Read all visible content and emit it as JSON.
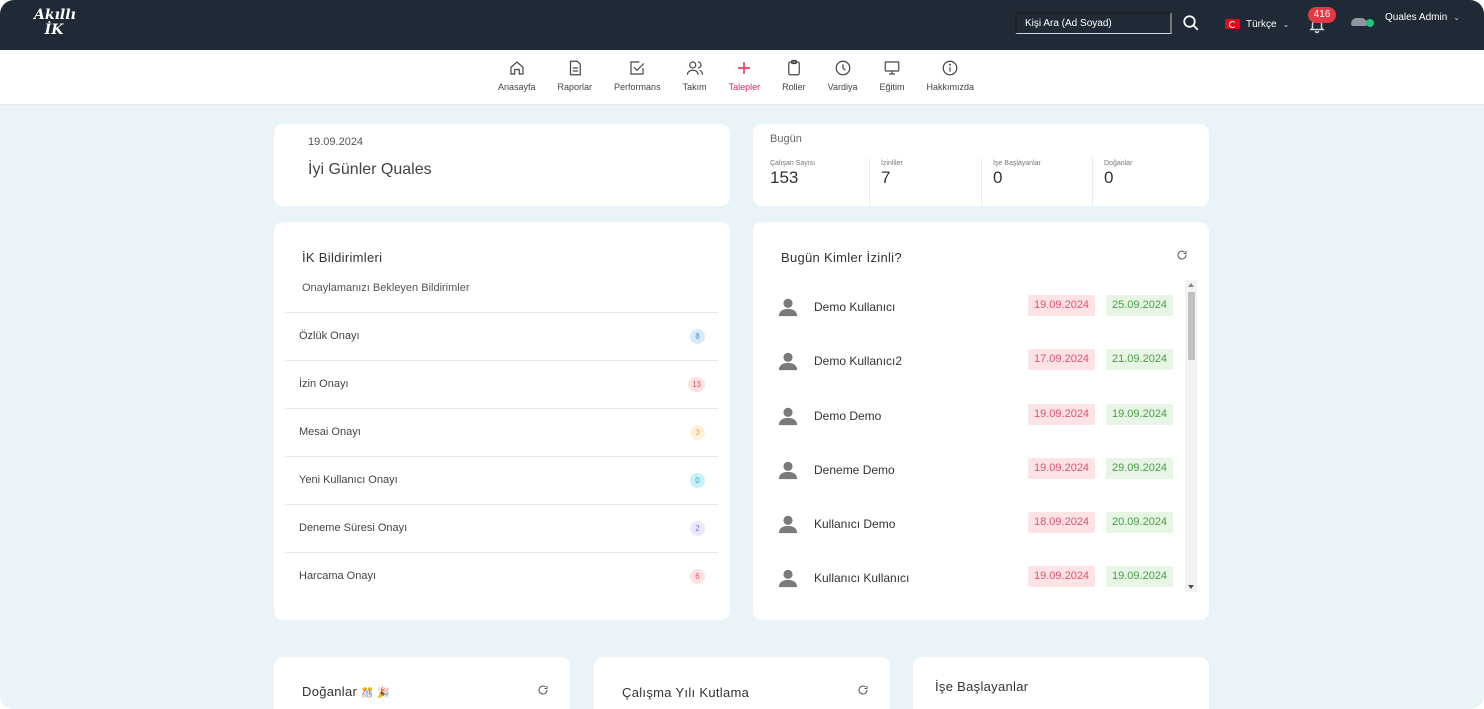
{
  "app": {
    "logo_line1": "Akıllı",
    "logo_line2": "İK"
  },
  "topbar": {
    "search_placeholder": "Kişi Ara (Ad Soyad)",
    "language": "Türkçe",
    "notification_count": "416",
    "user_name": "Quales Admin"
  },
  "nav": {
    "items": [
      {
        "label": "Anasayfa",
        "icon": "home-icon"
      },
      {
        "label": "Raporlar",
        "icon": "document-icon"
      },
      {
        "label": "Performans",
        "icon": "checkbox-icon"
      },
      {
        "label": "Takım",
        "icon": "users-icon"
      },
      {
        "label": "Talepler",
        "icon": "plus-icon",
        "active": true
      },
      {
        "label": "Roller",
        "icon": "clipboard-icon"
      },
      {
        "label": "Vardiya",
        "icon": "clock-icon"
      },
      {
        "label": "Eğitim",
        "icon": "monitor-icon"
      },
      {
        "label": "Hakkımızda",
        "icon": "info-icon"
      }
    ],
    "active_color": "#e8245a"
  },
  "greeting": {
    "date": "19.09.2024",
    "text": "İyi Günler Quales"
  },
  "today": {
    "label": "Bugün",
    "stats": [
      {
        "label": "Çalışan Sayısı",
        "value": "153"
      },
      {
        "label": "İzinliler",
        "value": "7"
      },
      {
        "label": "İşe Başlayanlar",
        "value": "0"
      },
      {
        "label": "Doğanlar",
        "value": "0"
      }
    ]
  },
  "hr_notifications": {
    "title": "İK Bildirimleri",
    "subtitle": "Onaylamanızı Bekleyen Bildirimler",
    "items": [
      {
        "label": "Özlük Onayı",
        "count": "8",
        "bg": "#d7ebf8",
        "fg": "#4a90c8"
      },
      {
        "label": "İzin Onayı",
        "count": "13",
        "bg": "#fde2e4",
        "fg": "#e0526a"
      },
      {
        "label": "Mesai Onayı",
        "count": "3",
        "bg": "#fdf1dd",
        "fg": "#e8a64a"
      },
      {
        "label": "Yeni Kullanıcı Onayı",
        "count": "0",
        "bg": "#c9f0f6",
        "fg": "#2aa9c0"
      },
      {
        "label": "Deneme Süresi Onayı",
        "count": "2",
        "bg": "#ebe8fb",
        "fg": "#7b6fd4"
      },
      {
        "label": "Harcama Onayı",
        "count": "6",
        "bg": "#fde2e4",
        "fg": "#e0526a"
      }
    ]
  },
  "on_leave_today": {
    "title": "Bugün Kimler İzinli?",
    "people": [
      {
        "name": "Demo Kullanıcı",
        "start": "19.09.2024",
        "end": "25.09.2024"
      },
      {
        "name": "Demo Kullanıcı2",
        "start": "17.09.2024",
        "end": "21.09.2024"
      },
      {
        "name": "Demo Demo",
        "start": "19.09.2024",
        "end": "19.09.2024"
      },
      {
        "name": "Deneme Demo",
        "start": "19.09.2024",
        "end": "29.09.2024"
      },
      {
        "name": "Kullanıcı Demo",
        "start": "18.09.2024",
        "end": "20.09.2024"
      },
      {
        "name": "Kullanıcı Kullanıcı",
        "start": "19.09.2024",
        "end": "19.09.2024"
      }
    ]
  },
  "birthdays": {
    "title": "Doğanlar",
    "emoji": "🎊 🎉"
  },
  "work_anniversary": {
    "title": "Çalışma Yılı Kutlama"
  },
  "new_starters": {
    "title": "İşe Başlayanlar"
  }
}
